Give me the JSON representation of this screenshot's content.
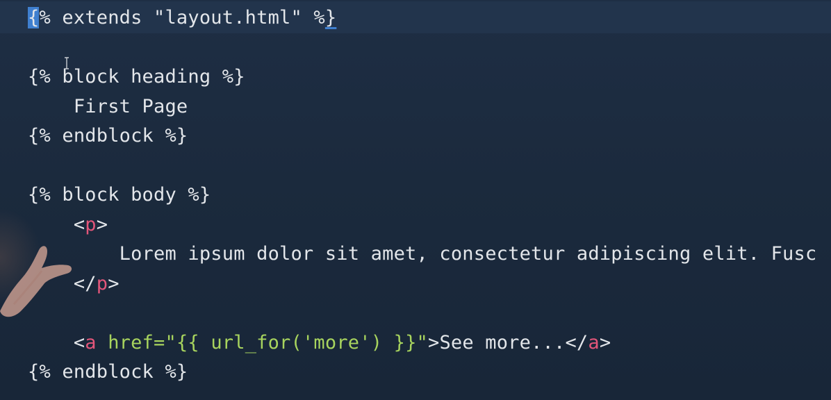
{
  "editor": {
    "colors": {
      "background": "#1b2a3d",
      "current_line": "#22344c",
      "text": "#e3e6ea",
      "html_tag": "#e3567a",
      "attribute_and_string": "#a8d45e",
      "cursor": "#3f7fcf"
    },
    "lines": [
      {
        "tokens": [
          {
            "text": "{",
            "kind": "cursor"
          },
          {
            "text": "% extends \"layout.html\" %",
            "kind": "jinja"
          },
          {
            "text": "}",
            "kind": "bracket"
          }
        ]
      },
      {
        "tokens": []
      },
      {
        "tokens": [
          {
            "text": "{% block heading %}",
            "kind": "jinja"
          }
        ]
      },
      {
        "tokens": [
          {
            "text": "    First Page",
            "kind": "text"
          }
        ]
      },
      {
        "tokens": [
          {
            "text": "{% endblock %}",
            "kind": "jinja"
          }
        ]
      },
      {
        "tokens": []
      },
      {
        "tokens": [
          {
            "text": "{% block body %}",
            "kind": "jinja"
          }
        ]
      },
      {
        "tokens": [
          {
            "text": "    <",
            "kind": "text"
          },
          {
            "text": "p",
            "kind": "tag"
          },
          {
            "text": ">",
            "kind": "text"
          }
        ]
      },
      {
        "tokens": [
          {
            "text": "        Lorem ipsum dolor sit amet, consectetur adipiscing elit. Fusc",
            "kind": "text"
          }
        ]
      },
      {
        "tokens": [
          {
            "text": "    </",
            "kind": "text"
          },
          {
            "text": "p",
            "kind": "tag"
          },
          {
            "text": ">",
            "kind": "text"
          }
        ]
      },
      {
        "tokens": []
      },
      {
        "tokens": [
          {
            "text": "    <",
            "kind": "text"
          },
          {
            "text": "a",
            "kind": "tag"
          },
          {
            "text": " ",
            "kind": "text"
          },
          {
            "text": "href=",
            "kind": "attr"
          },
          {
            "text": "\"{{ url_for('more') }}\"",
            "kind": "str"
          },
          {
            "text": ">See more...</",
            "kind": "text"
          },
          {
            "text": "a",
            "kind": "tag"
          },
          {
            "text": ">",
            "kind": "text"
          }
        ]
      },
      {
        "tokens": [
          {
            "text": "{% endblock %}",
            "kind": "jinja"
          }
        ]
      }
    ]
  }
}
